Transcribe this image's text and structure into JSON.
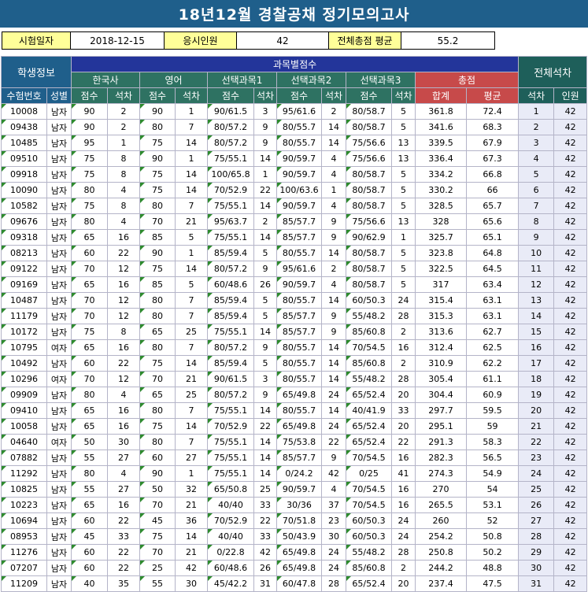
{
  "title": "18년12월 경찰공채 정기모의고사",
  "info": {
    "date_label": "시험일자",
    "date_value": "2018-12-15",
    "count_label": "응시인원",
    "count_value": "42",
    "avg_label": "전체총점 평균",
    "avg_value": "55.2"
  },
  "headers": {
    "student_info": "학생정보",
    "subject_scores": "과목별점수",
    "overall_rank": "전체석차",
    "subjects": [
      "한국사",
      "영어",
      "선택과목1",
      "선택과목2",
      "선택과목3"
    ],
    "total": "총점",
    "exam_no": "수험번호",
    "gender": "성별",
    "score": "점수",
    "rank": "석차",
    "sum": "합계",
    "avg": "평균",
    "rank2": "석차",
    "people": "인원"
  },
  "rows": [
    [
      "10008",
      "남자",
      "90",
      "2",
      "90",
      "1",
      "90/61.5",
      "3",
      "95/61.6",
      "2",
      "80/58.7",
      "5",
      "361.8",
      "72.4",
      "1",
      "42"
    ],
    [
      "09438",
      "남자",
      "90",
      "2",
      "80",
      "7",
      "80/57.2",
      "9",
      "80/55.7",
      "14",
      "80/58.7",
      "5",
      "341.6",
      "68.3",
      "2",
      "42"
    ],
    [
      "10485",
      "남자",
      "95",
      "1",
      "75",
      "14",
      "80/57.2",
      "9",
      "80/55.7",
      "14",
      "75/56.6",
      "13",
      "339.5",
      "67.9",
      "3",
      "42"
    ],
    [
      "09510",
      "남자",
      "75",
      "8",
      "90",
      "1",
      "75/55.1",
      "14",
      "90/59.7",
      "4",
      "75/56.6",
      "13",
      "336.4",
      "67.3",
      "4",
      "42"
    ],
    [
      "09918",
      "남자",
      "75",
      "8",
      "75",
      "14",
      "100/65.8",
      "1",
      "90/59.7",
      "4",
      "80/58.7",
      "5",
      "334.2",
      "66.8",
      "5",
      "42"
    ],
    [
      "10090",
      "남자",
      "80",
      "4",
      "75",
      "14",
      "70/52.9",
      "22",
      "100/63.6",
      "1",
      "80/58.7",
      "5",
      "330.2",
      "66",
      "6",
      "42"
    ],
    [
      "10582",
      "남자",
      "75",
      "8",
      "80",
      "7",
      "75/55.1",
      "14",
      "90/59.7",
      "4",
      "80/58.7",
      "5",
      "328.5",
      "65.7",
      "7",
      "42"
    ],
    [
      "09676",
      "남자",
      "80",
      "4",
      "70",
      "21",
      "95/63.7",
      "2",
      "85/57.7",
      "9",
      "75/56.6",
      "13",
      "328",
      "65.6",
      "8",
      "42"
    ],
    [
      "09318",
      "남자",
      "65",
      "16",
      "85",
      "5",
      "75/55.1",
      "14",
      "85/57.7",
      "9",
      "90/62.9",
      "1",
      "325.7",
      "65.1",
      "9",
      "42"
    ],
    [
      "08213",
      "남자",
      "60",
      "22",
      "90",
      "1",
      "85/59.4",
      "5",
      "80/55.7",
      "14",
      "80/58.7",
      "5",
      "323.8",
      "64.8",
      "10",
      "42"
    ],
    [
      "09122",
      "남자",
      "70",
      "12",
      "75",
      "14",
      "80/57.2",
      "9",
      "95/61.6",
      "2",
      "80/58.7",
      "5",
      "322.5",
      "64.5",
      "11",
      "42"
    ],
    [
      "09169",
      "남자",
      "65",
      "16",
      "85",
      "5",
      "60/48.6",
      "26",
      "90/59.7",
      "4",
      "80/58.7",
      "5",
      "317",
      "63.4",
      "12",
      "42"
    ],
    [
      "10487",
      "남자",
      "70",
      "12",
      "80",
      "7",
      "85/59.4",
      "5",
      "80/55.7",
      "14",
      "60/50.3",
      "24",
      "315.4",
      "63.1",
      "13",
      "42"
    ],
    [
      "11179",
      "남자",
      "70",
      "12",
      "80",
      "7",
      "85/59.4",
      "5",
      "85/57.7",
      "9",
      "55/48.2",
      "28",
      "315.3",
      "63.1",
      "14",
      "42"
    ],
    [
      "10172",
      "남자",
      "75",
      "8",
      "65",
      "25",
      "75/55.1",
      "14",
      "85/57.7",
      "9",
      "85/60.8",
      "2",
      "313.6",
      "62.7",
      "15",
      "42"
    ],
    [
      "10795",
      "여자",
      "65",
      "16",
      "80",
      "7",
      "80/57.2",
      "9",
      "80/55.7",
      "14",
      "70/54.5",
      "16",
      "312.4",
      "62.5",
      "16",
      "42"
    ],
    [
      "10492",
      "남자",
      "60",
      "22",
      "75",
      "14",
      "85/59.4",
      "5",
      "80/55.7",
      "14",
      "85/60.8",
      "2",
      "310.9",
      "62.2",
      "17",
      "42"
    ],
    [
      "10296",
      "여자",
      "70",
      "12",
      "70",
      "21",
      "90/61.5",
      "3",
      "80/55.7",
      "14",
      "55/48.2",
      "28",
      "305.4",
      "61.1",
      "18",
      "42"
    ],
    [
      "09909",
      "남자",
      "80",
      "4",
      "65",
      "25",
      "80/57.2",
      "9",
      "65/49.8",
      "24",
      "65/52.4",
      "20",
      "304.4",
      "60.9",
      "19",
      "42"
    ],
    [
      "09410",
      "남자",
      "65",
      "16",
      "80",
      "7",
      "75/55.1",
      "14",
      "80/55.7",
      "14",
      "40/41.9",
      "33",
      "297.7",
      "59.5",
      "20",
      "42"
    ],
    [
      "10058",
      "남자",
      "65",
      "16",
      "75",
      "14",
      "70/52.9",
      "22",
      "65/49.8",
      "24",
      "65/52.4",
      "20",
      "295.1",
      "59",
      "21",
      "42"
    ],
    [
      "04640",
      "여자",
      "50",
      "30",
      "80",
      "7",
      "75/55.1",
      "14",
      "75/53.8",
      "22",
      "65/52.4",
      "22",
      "291.3",
      "58.3",
      "22",
      "42"
    ],
    [
      "07882",
      "남자",
      "55",
      "27",
      "60",
      "27",
      "75/55.1",
      "14",
      "85/57.7",
      "9",
      "70/54.5",
      "16",
      "282.3",
      "56.5",
      "23",
      "42"
    ],
    [
      "11292",
      "남자",
      "80",
      "4",
      "90",
      "1",
      "75/55.1",
      "14",
      "0/24.2",
      "42",
      "0/25",
      "41",
      "274.3",
      "54.9",
      "24",
      "42"
    ],
    [
      "10825",
      "남자",
      "55",
      "27",
      "50",
      "32",
      "65/50.8",
      "25",
      "90/59.7",
      "4",
      "70/54.5",
      "16",
      "270",
      "54",
      "25",
      "42"
    ],
    [
      "10223",
      "남자",
      "65",
      "16",
      "70",
      "21",
      "40/40",
      "33",
      "30/36",
      "37",
      "70/54.5",
      "16",
      "265.5",
      "53.1",
      "26",
      "42"
    ],
    [
      "10694",
      "남자",
      "60",
      "22",
      "45",
      "36",
      "70/52.9",
      "22",
      "70/51.8",
      "23",
      "60/50.3",
      "24",
      "260",
      "52",
      "27",
      "42"
    ],
    [
      "08953",
      "남자",
      "45",
      "33",
      "75",
      "14",
      "40/40",
      "33",
      "50/43.9",
      "30",
      "60/50.3",
      "24",
      "254.2",
      "50.8",
      "28",
      "42"
    ],
    [
      "11276",
      "남자",
      "60",
      "22",
      "70",
      "21",
      "0/22.8",
      "42",
      "65/49.8",
      "24",
      "55/48.2",
      "28",
      "250.8",
      "50.2",
      "29",
      "42"
    ],
    [
      "07207",
      "남자",
      "60",
      "22",
      "25",
      "42",
      "60/48.6",
      "26",
      "65/49.8",
      "24",
      "85/60.8",
      "2",
      "244.2",
      "48.8",
      "30",
      "42"
    ],
    [
      "11209",
      "남자",
      "40",
      "35",
      "55",
      "30",
      "45/42.2",
      "31",
      "60/47.8",
      "28",
      "65/52.4",
      "20",
      "237.4",
      "47.5",
      "31",
      "42"
    ]
  ]
}
